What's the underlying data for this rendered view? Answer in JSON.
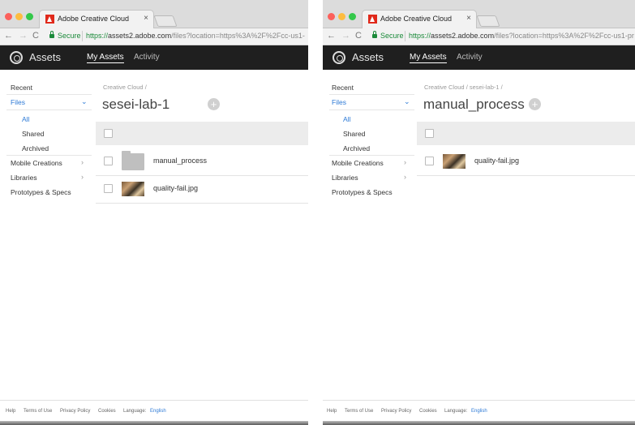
{
  "tab_title": "Adobe Creative Cloud",
  "tab_close": "×",
  "secure_label": "Secure",
  "url_scheme": "https://",
  "url_host": "assets2.adobe.com",
  "url_path_left": "/files?location=https%3A%2F%2Fcc-us1-",
  "url_path_right": "/files?location=https%3A%2F%2Fcc-us1-pr",
  "brand": "Assets",
  "nav": {
    "my_assets": "My Assets",
    "activity": "Activity"
  },
  "sidebar": {
    "recent": "Recent",
    "files": "Files",
    "all": "All",
    "shared": "Shared",
    "archived": "Archived",
    "mobile": "Mobile Creations",
    "libraries": "Libraries",
    "prototypes": "Prototypes & Specs"
  },
  "left": {
    "breadcrumb": "Creative Cloud  /",
    "title": "sesei-lab-1",
    "rows": [
      {
        "name": "manual_process",
        "type": "folder"
      },
      {
        "name": "quality-fail.jpg",
        "type": "image"
      }
    ]
  },
  "right": {
    "breadcrumb": "Creative Cloud  /  sesei-lab-1  /",
    "title": "manual_process",
    "rows": [
      {
        "name": "quality-fail.jpg",
        "type": "image"
      }
    ]
  },
  "footer": {
    "help": "Help",
    "terms": "Terms of Use",
    "privacy": "Privacy Policy",
    "cookies": "Cookies",
    "language_label": "Language:",
    "language": "English"
  },
  "colors": {
    "accent": "#2d7ad6",
    "header": "#1f1f1f",
    "secure": "#1b8a3a"
  },
  "icons": [
    "close-icon",
    "back-arrow-icon",
    "forward-arrow-icon",
    "reload-icon",
    "lock-icon",
    "creative-cloud-logo-icon",
    "chevron-down-icon",
    "chevron-right-icon",
    "add-icon",
    "folder-icon",
    "checkbox-icon"
  ]
}
